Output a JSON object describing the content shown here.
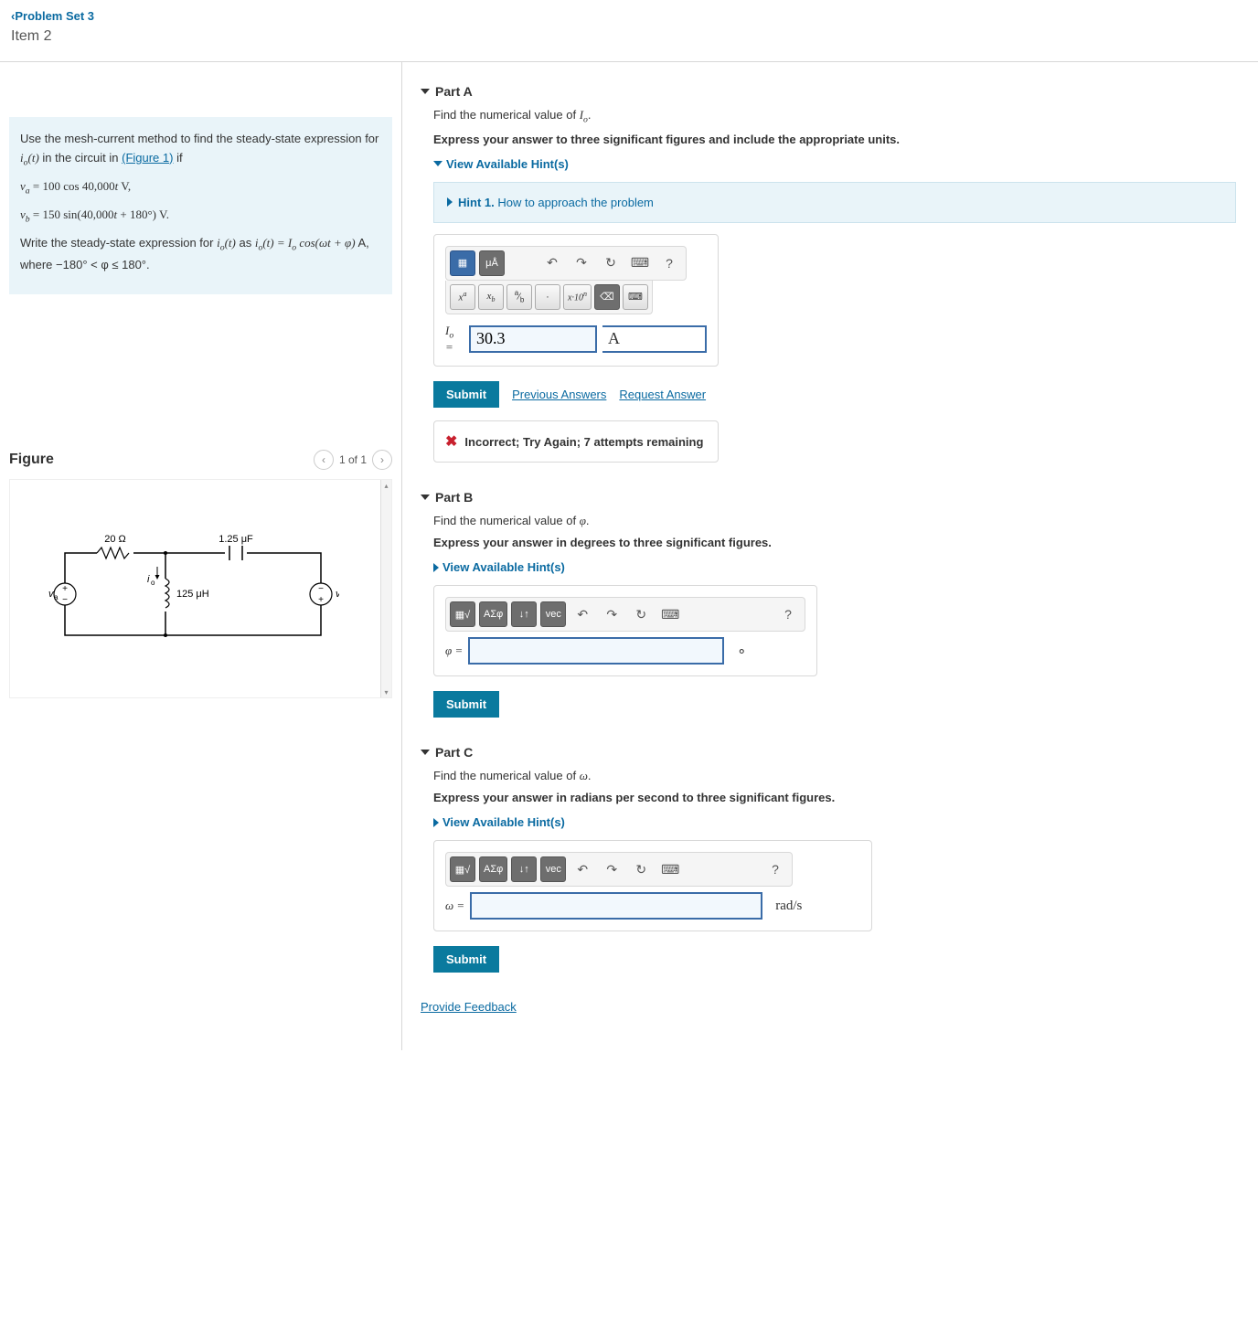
{
  "header": {
    "back_link": "Problem Set 3",
    "item_title": "Item 2"
  },
  "problem": {
    "p1_a": "Use the mesh-current method to find the steady-state expression for ",
    "p1_b": " in the circuit in ",
    "figure_link": "(Figure 1)",
    "p1_c": " if",
    "eq1": "vₐ = 100 cos 40,000t V,",
    "eq2": "v_b = 150 sin(40,000t + 180°) V.",
    "p3_a": "Write the steady-state expression for ",
    "p3_b": " as ",
    "p3_c": ", where ",
    "p3_d": "−180° < φ ≤ 180°."
  },
  "figure": {
    "title": "Figure",
    "pager": "1 of 1",
    "labels": {
      "r": "20 Ω",
      "c": "1.25 μF",
      "l": "125 μH",
      "va": "vₐ",
      "vb": "v_b",
      "io": "iₒ"
    }
  },
  "partA": {
    "title": "Part A",
    "prompt1": "Find the numerical value of Iₒ.",
    "prompt2": "Express your answer to three significant figures and include the appropriate units.",
    "hints_link": "View Available Hint(s)",
    "hint1_label": "Hint 1.",
    "hint1_text": " How to approach the problem",
    "toolbar": {
      "templates": "μÅ",
      "xa": "xᵃ",
      "xb": "xᵦ",
      "frac": "a⁄b",
      "dot": "·",
      "sci": "x·10ⁿ"
    },
    "answer_label": "Iₒ =",
    "answer_value": "30.3",
    "answer_unit": "A",
    "submit": "Submit",
    "prev_ans": "Previous Answers",
    "req_ans": "Request Answer",
    "feedback": "Incorrect; Try Again; 7 attempts remaining"
  },
  "partB": {
    "title": "Part B",
    "prompt1": "Find the numerical value of φ.",
    "prompt2": "Express your answer in degrees to three significant figures.",
    "hints_link": "View Available Hint(s)",
    "answer_label": "φ =",
    "deg": "∘",
    "submit": "Submit"
  },
  "partC": {
    "title": "Part C",
    "prompt1": "Find the numerical value of ω.",
    "prompt2": "Express your answer in radians per second to three significant figures.",
    "hints_link": "View Available Hint(s)",
    "answer_label": "ω =",
    "unit": "rad/s",
    "submit": "Submit"
  },
  "shared_toolbar": {
    "greek": "ΑΣφ",
    "updown": "↓↑",
    "vec": "vec",
    "undo": "↶",
    "redo": "↷",
    "reset": "↻",
    "kbd": "⌨",
    "help": "?"
  },
  "feedback_link": "Provide Feedback"
}
